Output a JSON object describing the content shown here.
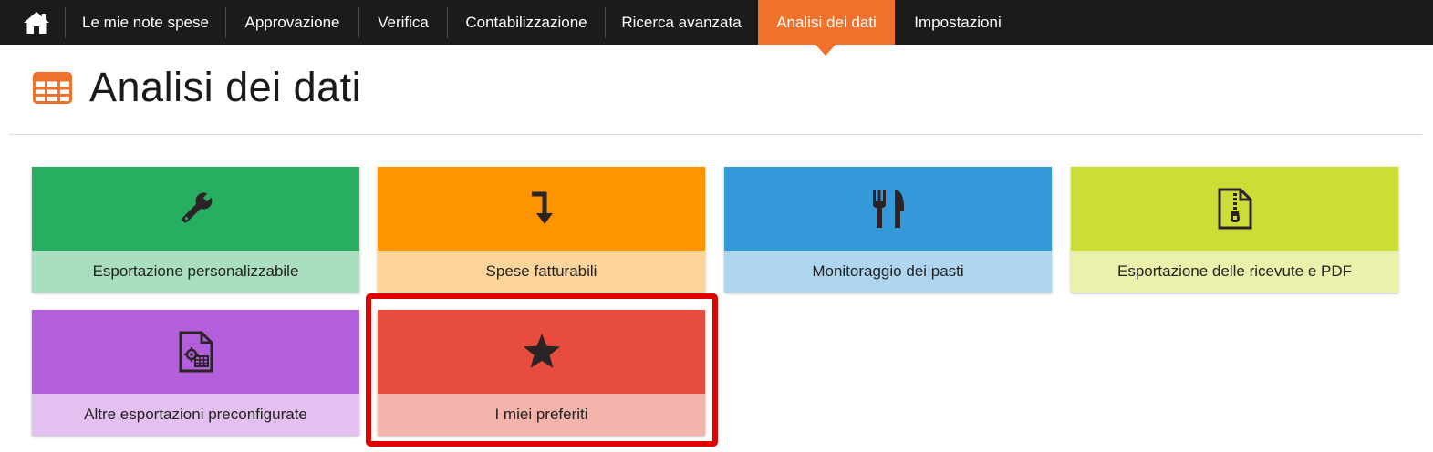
{
  "nav": {
    "home_icon": "home-icon",
    "items": [
      {
        "label": "Le mie note spese"
      },
      {
        "label": "Approvazione"
      },
      {
        "label": "Verifica"
      },
      {
        "label": "Contabilizzazione"
      },
      {
        "label": "Ricerca avanzata"
      },
      {
        "label": "Analisi dei dati",
        "active": true
      },
      {
        "label": "Impostazioni"
      }
    ]
  },
  "header": {
    "icon": "table-icon",
    "title": "Analisi dei dati"
  },
  "tiles": [
    {
      "label": "Esportazione personalizzabile",
      "icon": "wrench-icon",
      "color": "#27ae60",
      "light_color": "#a9dfbf"
    },
    {
      "label": "Spese fatturabili",
      "icon": "level-down-arrow-icon",
      "color": "#fe9500",
      "light_color": "#fdd59a"
    },
    {
      "label": "Monitoraggio dei pasti",
      "icon": "cutlery-icon",
      "color": "#3498db",
      "light_color": "#aed6f1"
    },
    {
      "label": "Esportazione delle ricevute e PDF",
      "icon": "zip-file-icon",
      "color": "#cddd38",
      "light_color": "#e9f1ab"
    },
    {
      "label": "Altre esportazioni preconfigurate",
      "icon": "spreadsheet-settings-icon",
      "color": "#b35fdb",
      "light_color": "#e3c0f0"
    },
    {
      "label": "I miei preferiti",
      "icon": "star-icon",
      "color": "#e74c3c",
      "light_color": "#f4b4ab",
      "highlighted": true
    }
  ],
  "colors": {
    "nav_background": "#1b1b1b",
    "accent": "#f0712b",
    "highlight_border": "#e00000",
    "icon_dark": "#2b2326"
  }
}
